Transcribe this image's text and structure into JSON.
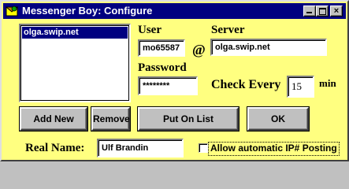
{
  "window": {
    "title": "Messenger Boy: Configure",
    "controls": {
      "minimize": "_",
      "maximize": "□",
      "close": "×"
    }
  },
  "server_list": {
    "items": [
      "olga.swip.net"
    ],
    "selected_index": 0
  },
  "user": {
    "label": "User",
    "value": "mo65587"
  },
  "at_symbol": "@",
  "server": {
    "label": "Server",
    "value": "olga.swip.net"
  },
  "password": {
    "label": "Password",
    "value": "********"
  },
  "check_every": {
    "label": "Check Every",
    "value": "15",
    "unit": "min"
  },
  "buttons": {
    "add_new": "Add New",
    "remove": "Remove",
    "put_on_list": "Put On List",
    "ok": "OK"
  },
  "real_name": {
    "label": "Real Name:",
    "value": "Ulf Brandin"
  },
  "allow_ip_posting": {
    "label": "Allow automatic IP# Posting",
    "checked": false
  },
  "colors": {
    "window_background": "#ffff80",
    "titlebar": "#000080",
    "selection": "#000080",
    "button_face": "#c0c0c0"
  }
}
